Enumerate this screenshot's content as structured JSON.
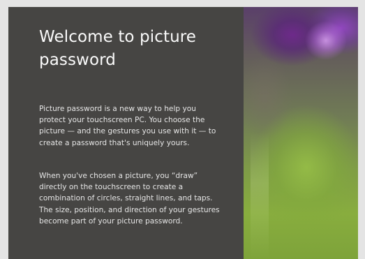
{
  "intro": {
    "title": "Welcome to picture password",
    "paragraph_1": "Picture password is a new way to help you protect your touchscreen PC. You choose the picture — and the gestures you use with it — to create a password that's uniquely yours.",
    "paragraph_2": "When you've chosen a picture, you “draw” directly on the touchscreen to create a combination of circles, straight lines, and taps. The size, position, and direction of your gestures become part of your picture password."
  },
  "background_image": {
    "subject": "purple flowers on green background"
  },
  "colors": {
    "panel": "#464543",
    "text": "#f2f2f2"
  }
}
